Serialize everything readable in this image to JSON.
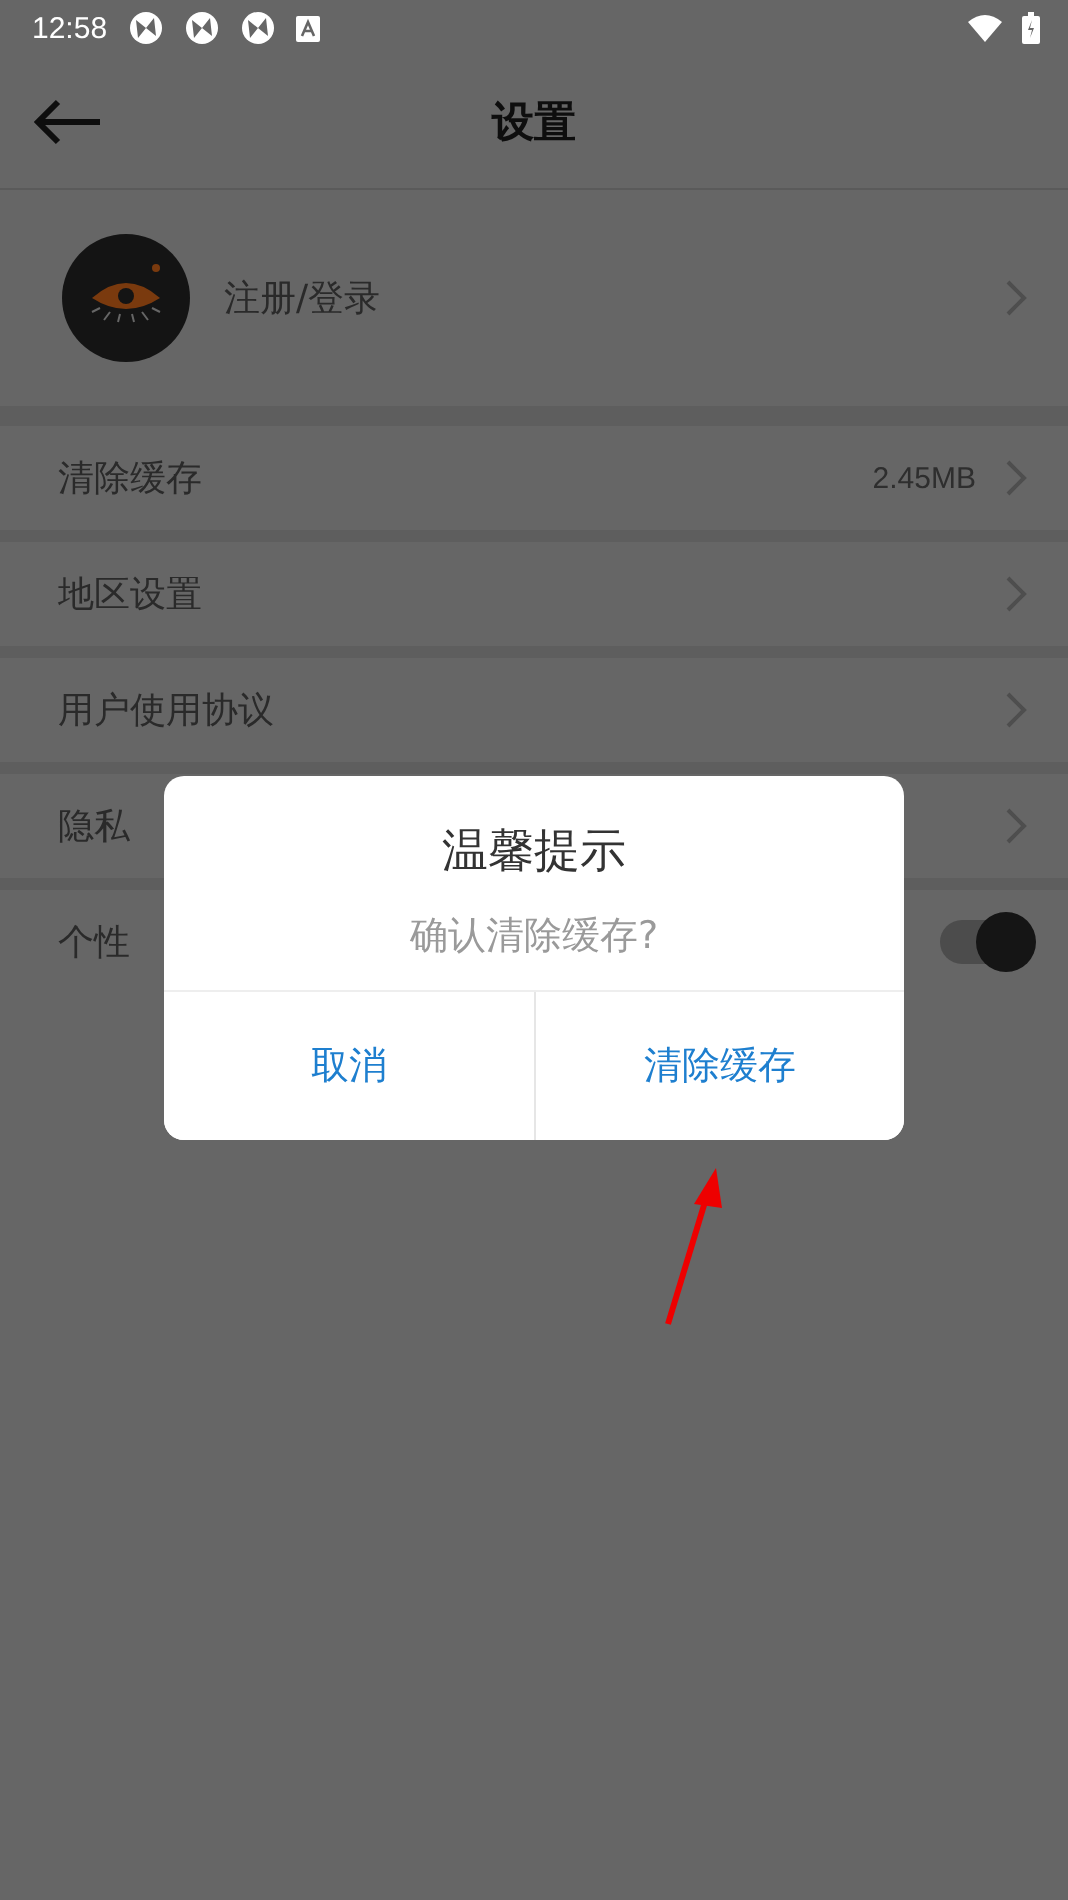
{
  "status_bar": {
    "time": "12:58"
  },
  "header": {
    "title": "设置"
  },
  "profile": {
    "label": "注册/登录"
  },
  "rows": [
    {
      "kind": "link",
      "label": "清除缓存",
      "value": "2.45MB"
    },
    {
      "kind": "link",
      "label": "地区设置"
    },
    {
      "kind": "link",
      "label": "用户使用协议"
    },
    {
      "kind": "link",
      "label": "隐私"
    },
    {
      "kind": "toggle",
      "label": "个性",
      "on": true
    }
  ],
  "dialog": {
    "title": "温馨提示",
    "message": "确认清除缓存?",
    "buttons": [
      "取消",
      "清除缓存"
    ]
  }
}
